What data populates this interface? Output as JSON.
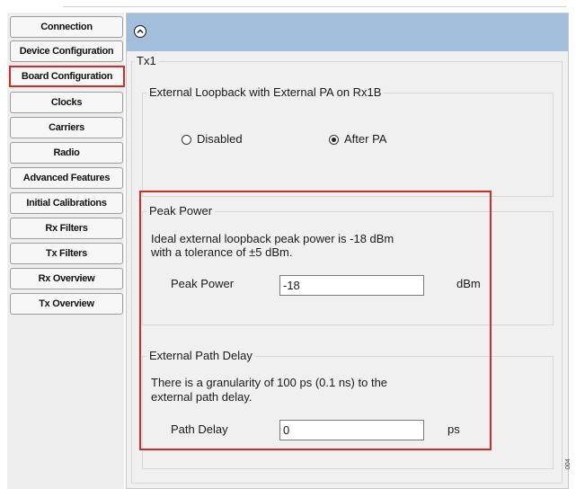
{
  "sidebar": {
    "items": [
      {
        "label": "Connection"
      },
      {
        "label": "Device Configuration"
      },
      {
        "label": "Board Configuration",
        "active": true
      },
      {
        "label": "Clocks"
      },
      {
        "label": "Carriers"
      },
      {
        "label": "Radio"
      },
      {
        "label": "Advanced Features"
      },
      {
        "label": "Initial Calibrations"
      },
      {
        "label": "Rx Filters"
      },
      {
        "label": "Tx Filters"
      },
      {
        "label": "Rx Overview"
      },
      {
        "label": "Tx Overview"
      }
    ]
  },
  "panel": {
    "collapse_icon": "chevron-up-circle-icon",
    "tx_group_title": "Tx1",
    "loopback": {
      "title": "External Loopback with External PA on Rx1B",
      "options": [
        {
          "label": "Disabled",
          "checked": false
        },
        {
          "label": "After PA",
          "checked": true
        }
      ]
    },
    "peak_power": {
      "title": "Peak Power",
      "description_line1": "Ideal external loopback peak power is -18 dBm",
      "description_line2": "with a tolerance of ±5 dBm.",
      "field_label": "Peak Power",
      "value": "-18",
      "unit": "dBm"
    },
    "path_delay": {
      "title": "External Path Delay",
      "description_line1": "There is a granularity of 100 ps (0.1 ns) to the",
      "description_line2": "external path delay.",
      "field_label": "Path Delay",
      "value": "0",
      "unit": "ps"
    }
  },
  "figure_code": "004",
  "colors": {
    "header": "#a3bedb",
    "highlight": "#d42a2a",
    "panel": "#f0f0f0"
  }
}
